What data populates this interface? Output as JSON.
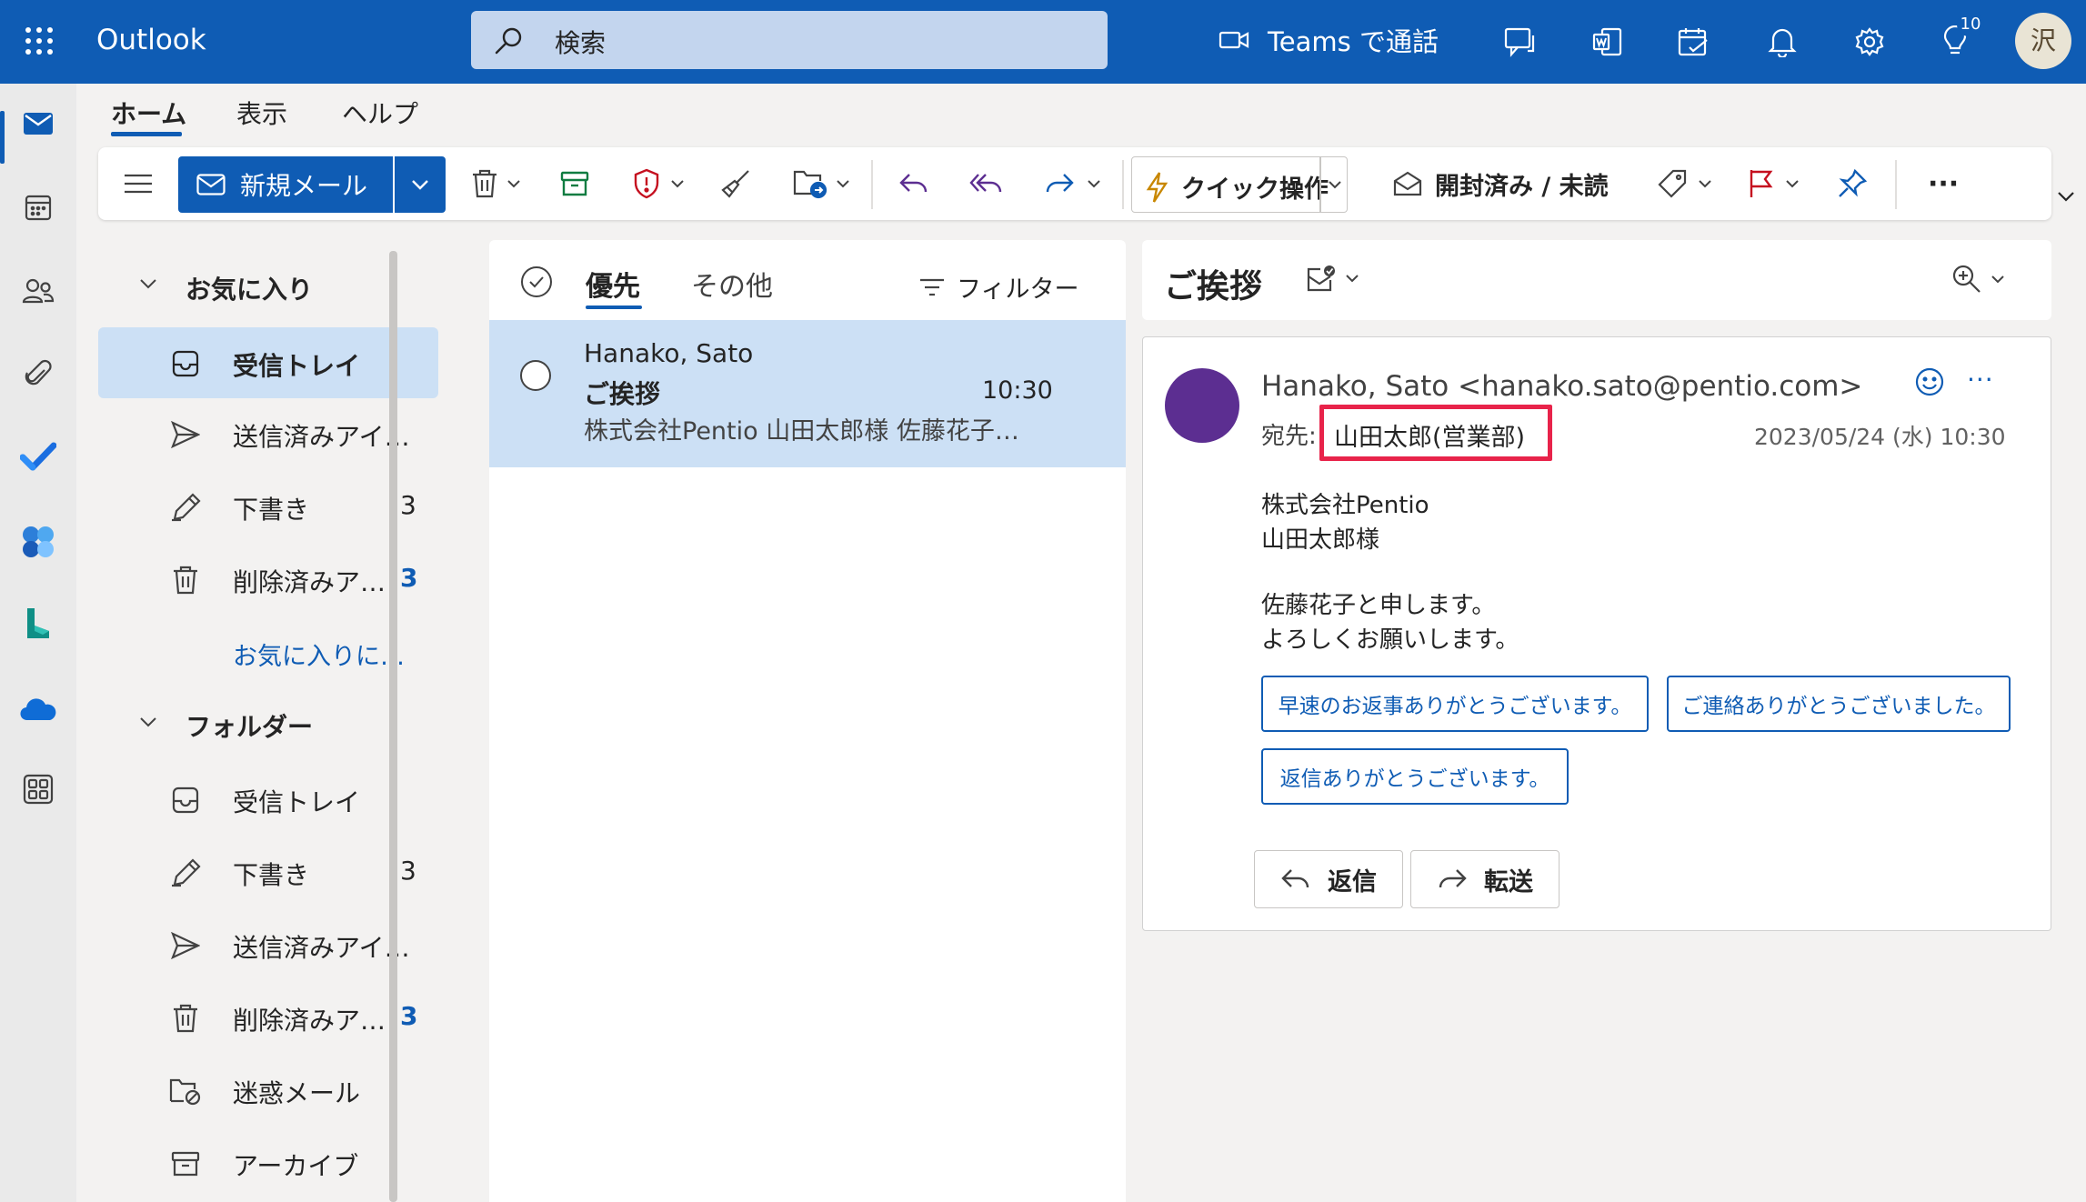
{
  "app": {
    "title": "Outlook"
  },
  "search": {
    "placeholder": "検索"
  },
  "header": {
    "teams_label": "Teams で通話",
    "notification_count": "10",
    "avatar_initial": "沢"
  },
  "ribbon": {
    "tabs": [
      {
        "label": "ホーム",
        "active": true
      },
      {
        "label": "表示",
        "active": false
      },
      {
        "label": "ヘルプ",
        "active": false
      }
    ]
  },
  "toolbar": {
    "new_mail": "新規メール",
    "quick_steps": "クイック操作",
    "read_unread": "開封済み / 未読",
    "more": "···"
  },
  "folders": {
    "favorites_header": "お気に入り",
    "favorites": [
      {
        "label": "受信トレイ",
        "count": "",
        "selected": true
      },
      {
        "label": "送信済みアイ…",
        "count": ""
      },
      {
        "label": "下書き",
        "count": "3"
      },
      {
        "label": "削除済みア…",
        "count": "3"
      }
    ],
    "add_favorite": "お気に入りに…",
    "folders_header": "フォルダー",
    "folders": [
      {
        "label": "受信トレイ",
        "count": ""
      },
      {
        "label": "下書き",
        "count": "3"
      },
      {
        "label": "送信済みアイ…",
        "count": ""
      },
      {
        "label": "削除済みア…",
        "count": "3"
      },
      {
        "label": "迷惑メール",
        "count": ""
      },
      {
        "label": "アーカイブ",
        "count": ""
      }
    ]
  },
  "message_list": {
    "tab_focused": "優先",
    "tab_other": "その他",
    "filter": "フィルター",
    "items": [
      {
        "sender": "Hanako, Sato",
        "subject": "ご挨拶",
        "time": "10:30",
        "preview": "株式会社Pentio 山田太郎様 佐藤花子…"
      }
    ]
  },
  "reading_pane": {
    "subject": "ご挨拶",
    "from": "Hanako, Sato <hanako.sato@pentio.com>",
    "to_label": "宛先:",
    "to_name": "山田太郎(営業部)",
    "date": "2023/05/24 (水) 10:30",
    "more": "···",
    "body": [
      "株式会社Pentio",
      "山田太郎様",
      "佐藤花子と申します。",
      "よろしくお願いします。"
    ],
    "suggested_replies": [
      "早速のお返事ありがとうございます。",
      "ご連絡ありがとうございました。",
      "返信ありがとうございます。"
    ],
    "reply": "返信",
    "forward": "転送"
  },
  "colors": {
    "brand": "#0f5cb4",
    "selected": "#cce0f5",
    "highlight_box": "#e8234a",
    "sender_avatar": "#5c2e91"
  },
  "icons": [
    "waffle-icon",
    "search-icon",
    "video-icon",
    "chat-icon",
    "word-icon",
    "my-day-icon",
    "bell-icon",
    "gear-icon",
    "lightbulb-icon",
    "mail-icon",
    "calendar-icon",
    "people-icon",
    "attach-icon",
    "todo-icon",
    "office-icon",
    "bookings-icon",
    "onedrive-icon",
    "apps-icon"
  ]
}
